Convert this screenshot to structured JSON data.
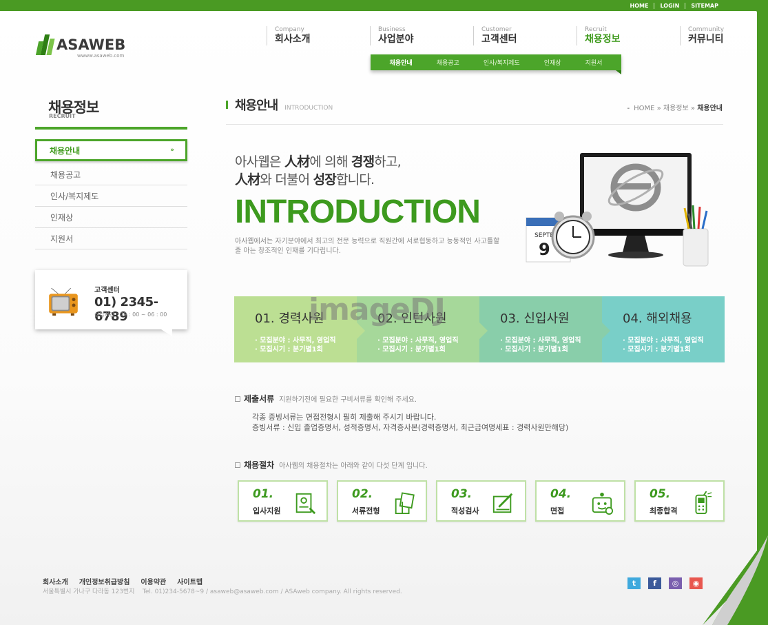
{
  "util": [
    "HOME",
    "LOGIN",
    "SITEMAP"
  ],
  "logo": {
    "name": "ASAWEB",
    "url": "wwww.asaweb.com"
  },
  "gnb": [
    {
      "en": "Company",
      "ko": "회사소개"
    },
    {
      "en": "Business",
      "ko": "사업분야"
    },
    {
      "en": "Customer",
      "ko": "고객센터"
    },
    {
      "en": "Recruit",
      "ko": "채용정보"
    },
    {
      "en": "Community",
      "ko": "커뮤니티"
    }
  ],
  "subnav": [
    "채용안내",
    "채용공고",
    "인사/복지제도",
    "인재상",
    "지원서"
  ],
  "lnb": {
    "title": "채용정보",
    "sub": "RECRUIT",
    "items": [
      "채용안내",
      "채용공고",
      "인사/복지제도",
      "인재상",
      "지원서"
    ]
  },
  "cs": {
    "label": "고객센터",
    "phone": "01) 2345-6789",
    "hours": "상담시간 : 09 : 00 ~ 06 : 00"
  },
  "page": {
    "title": "채용안내",
    "title_en": "INTRODUCTION",
    "bread_home": "HOME",
    "bread_mid": "채용정보",
    "bread_cur": "채용안내"
  },
  "intro": {
    "line1_a": "아사웹은 ",
    "line1_b": "人材",
    "line1_c": "에 의해 ",
    "line1_d": "경쟁",
    "line1_e": "하고,",
    "line2_a": "人材",
    "line2_b": "와 더불어 ",
    "line2_c": "성장",
    "line2_d": "합니다.",
    "big": "INTRODUCTION",
    "desc": "아사웹에서는 자기분야에서 최고의 전문 능력으로 직원간에 서로협동하고 능동적인 사고틀할 줄 아는 창조적인 인재를 기다립니다."
  },
  "steps": [
    {
      "num": "01. 경력사원",
      "l1": "· 모집분야 : 사무직, 영업직",
      "l2": "· 모집시기 : 분기별1회",
      "color": "#bcdf93"
    },
    {
      "num": "02. 인턴사원",
      "l1": "· 모집분야 : 사무직, 영업직",
      "l2": "· 모집시기 : 분기별1회",
      "color": "#a6d89a"
    },
    {
      "num": "03. 신입사원",
      "l1": "· 모집분야 : 사무직, 영업직",
      "l2": "· 모집시기 : 분기별1회",
      "color": "#89ceaa"
    },
    {
      "num": "04. 해외채용",
      "l1": "· 모집분야 : 사무직, 영업직",
      "l2": "· 모집시기 : 분기별1회",
      "color": "#79cfc8"
    }
  ],
  "watermark": "imageDJ",
  "docs": {
    "title": "제출서류",
    "sub": "지원하기전에 필요한 구비서류를 확인해 주세요.",
    "line1": "각종 증빙서류는 면접전형시 필히 제출해 주시기 바랍니다.",
    "line2": "증빙서류 : 신입 졸업증명서, 성적증명서, 자격증사본(경력증명서, 최근급여명세표 : 경력사원만해당)"
  },
  "proc": {
    "title": "채용절차",
    "sub": "아사웹의 채용절차는 아래와 같이 다섯 단계 입니다.",
    "items": [
      {
        "n": "01.",
        "l": "입사지원",
        "icon": "form-icon"
      },
      {
        "n": "02.",
        "l": "서류전형",
        "icon": "documents-icon"
      },
      {
        "n": "03.",
        "l": "적성검사",
        "icon": "pen-test-icon"
      },
      {
        "n": "04.",
        "l": "면접",
        "icon": "interview-icon"
      },
      {
        "n": "05.",
        "l": "최종합격",
        "icon": "phone-icon"
      }
    ]
  },
  "footer": {
    "links": [
      "회사소개",
      "개인정보취급방침",
      "이용약관",
      "사이트맵"
    ],
    "addr": "서울특별시 가나구 다라동 123번지    Tel. 01)234-5678~9 / asaweb@asaweb.com / ASAweb company. All rights reserved."
  },
  "sns": [
    {
      "icon": "twitter-icon",
      "g": "t",
      "color": "#3fa9dd"
    },
    {
      "icon": "facebook-icon",
      "g": "f",
      "color": "#3b5a9a"
    },
    {
      "icon": "me2day-icon",
      "g": "◎",
      "color": "#7a5fae"
    },
    {
      "icon": "cyworld-icon",
      "g": "◉",
      "color": "#e8574f"
    }
  ]
}
